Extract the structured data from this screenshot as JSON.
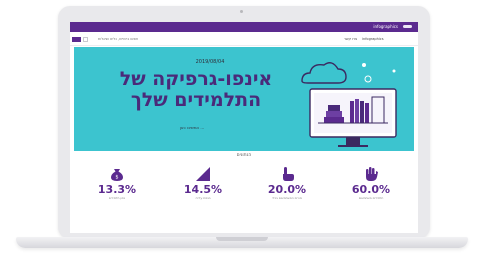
{
  "site": {
    "name": "infographics"
  },
  "nav": {
    "search_placeholder": "חפשו ביטויים, כלים ושאלות",
    "links": [
      "צרו קשר",
      "infographics"
    ]
  },
  "hero": {
    "date": "2019/08/04",
    "title_line1": "אינפו-גרפיקה של",
    "title_line2": "התלמידים שלך",
    "cta": "המשיכו כאן ..."
  },
  "section_label": "הנתונים",
  "stats": [
    {
      "value": "13.3%",
      "caption": "נתון תלמידים",
      "icon": "money-bag-icon"
    },
    {
      "value": "14.5%",
      "caption": "מגמת עלייה",
      "icon": "growth-chart-icon"
    },
    {
      "value": "20.0%",
      "caption": "מורים המשתמשים בכלי",
      "icon": "pointing-hand-icon"
    },
    {
      "value": "60.0%",
      "caption": "תלמידים משתמשים",
      "icon": "raised-hand-icon"
    }
  ],
  "colors": {
    "purple": "#5b2a8f",
    "hero_teal": "#3cc4cf",
    "title_purple": "#4a2a7a"
  }
}
